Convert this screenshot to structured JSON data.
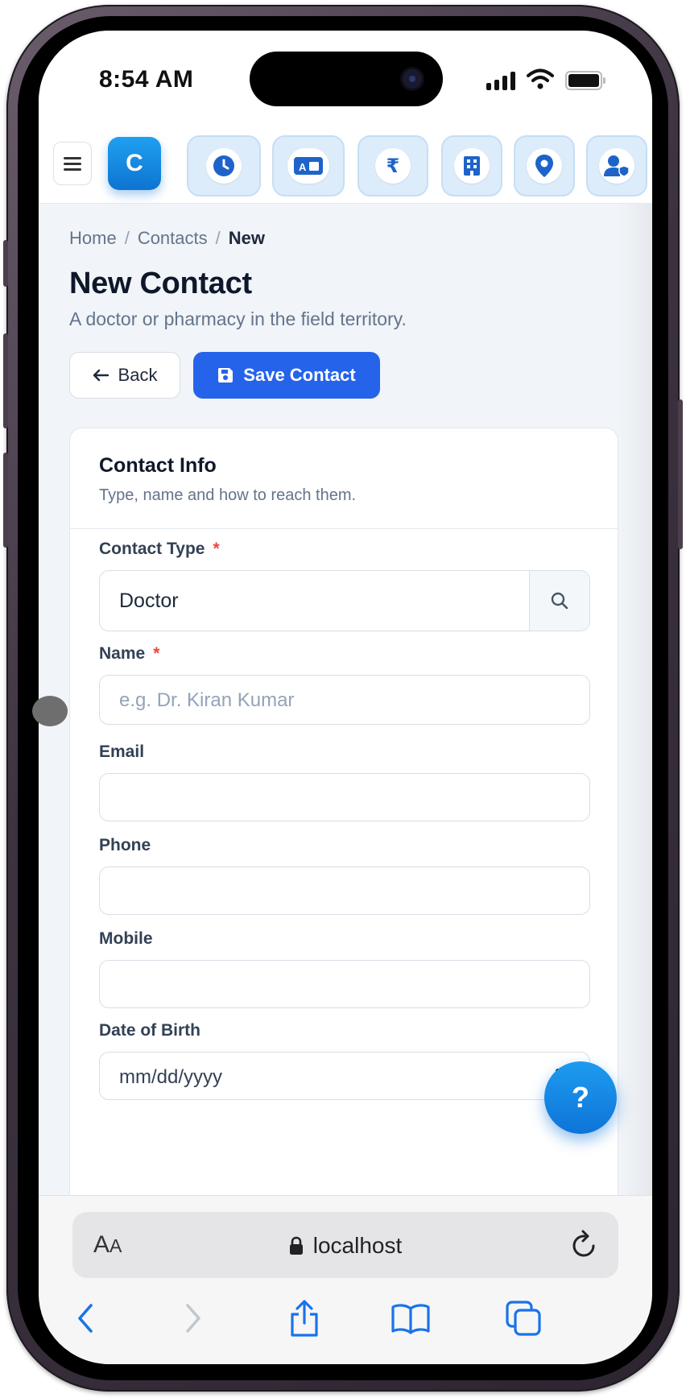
{
  "status_bar": {
    "time": "8:54 AM"
  },
  "toolbar": {
    "logo_letter": "C",
    "modules": [
      {
        "icon": "clock-icon"
      },
      {
        "icon": "id-card-icon"
      },
      {
        "icon": "rupee-icon",
        "glyph": "₹"
      },
      {
        "icon": "building-icon"
      },
      {
        "icon": "map-pin-icon"
      },
      {
        "icon": "user-shield-icon"
      }
    ],
    "accent": "#0d74d1"
  },
  "breadcrumb": {
    "home": "Home",
    "contacts": "Contacts",
    "current": "New",
    "separator": "/"
  },
  "page": {
    "title": "New Contact",
    "subtitle": "A doctor or pharmacy in the field territory."
  },
  "actions": {
    "back_label": "Back",
    "save_label": "Save Contact",
    "save_color": "#2563eb"
  },
  "card": {
    "title": "Contact Info",
    "subtitle": "Type, name and how to reach them."
  },
  "form": {
    "contact_type": {
      "label": "Contact Type",
      "required_mark": "*",
      "value": "Doctor"
    },
    "name": {
      "label": "Name",
      "required_mark": "*",
      "placeholder": "e.g. Dr. Kiran Kumar"
    },
    "email": {
      "label": "Email",
      "value": ""
    },
    "phone": {
      "label": "Phone",
      "value": ""
    },
    "mobile": {
      "label": "Mobile",
      "value": ""
    },
    "dob": {
      "label": "Date of Birth",
      "placeholder": "mm/dd/yyyy"
    }
  },
  "help_button": {
    "label": "?"
  },
  "browser": {
    "aa_big": "A",
    "aa_small": "A",
    "url": "localhost"
  }
}
